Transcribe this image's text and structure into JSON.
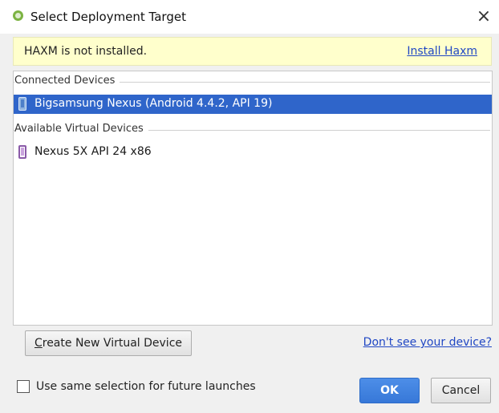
{
  "window": {
    "title": "Select Deployment Target",
    "app_icon": "android-studio-icon",
    "close_icon": "×"
  },
  "notice": {
    "message": "HAXM is not installed.",
    "link": "Install Haxm"
  },
  "sections": {
    "connected": {
      "label": "Connected Devices",
      "devices": [
        {
          "name": "Bigsamsung Nexus (Android 4.4.2, API 19)",
          "icon": "phone-icon",
          "selected": true
        }
      ]
    },
    "virtual": {
      "label": "Available Virtual Devices",
      "devices": [
        {
          "name": "Nexus 5X API 24 x86",
          "icon": "virtual-device-icon",
          "selected": false
        }
      ]
    }
  },
  "actions": {
    "create_prefix": "C",
    "create_rest": "reate New Virtual Device",
    "help_link": "Don't see your device?",
    "remember_label": "Use same selection for future launches",
    "remember_checked": false,
    "ok": "OK",
    "cancel": "Cancel"
  },
  "colors": {
    "selection": "#2f65ca",
    "notice_bg": "#ffffcc",
    "link": "#2047c4",
    "primary_button": "#3f82e0"
  }
}
